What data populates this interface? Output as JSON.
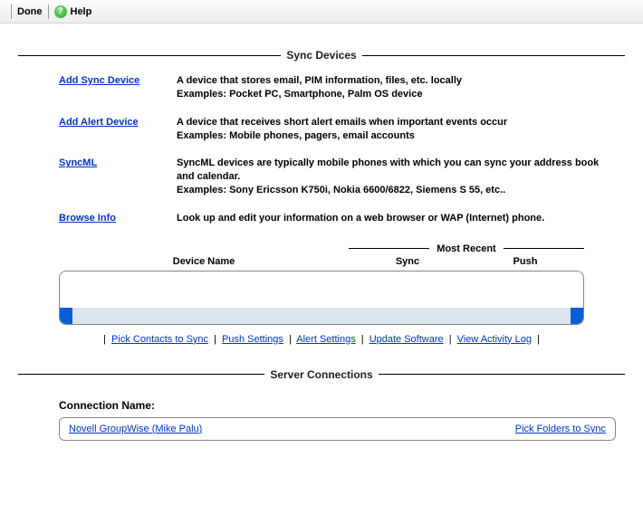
{
  "toolbar": {
    "done": "Done",
    "help": "Help"
  },
  "sections": {
    "sync_devices_title": "Sync Devices",
    "server_connections_title": "Server Connections"
  },
  "defs": [
    {
      "link": "Add Sync Device",
      "desc": "A device that stores email, PIM information, files, etc. locally\nExamples: Pocket PC, Smartphone, Palm OS device"
    },
    {
      "link": "Add Alert Device",
      "desc": "A device that receives short alert emails when important events occur\nExamples: Mobile phones, pagers, email accounts"
    },
    {
      "link": "SyncML",
      "desc": "SyncML devices are typically mobile phones with which you can sync your address book and calendar.\nExamples: Sony Ericsson K750i, Nokia 6600/6822, Siemens S 55, etc.."
    },
    {
      "link": "Browse Info",
      "desc": "Look up and edit your information on a web browser or WAP (Internet) phone."
    }
  ],
  "table": {
    "most_recent": "Most Recent",
    "device_name": "Device Name",
    "sync": "Sync",
    "push": "Push"
  },
  "links": {
    "pick_contacts": "Pick Contacts to Sync",
    "push_settings": "Push Settings",
    "alert_settings": "Alert Settings",
    "update_software": "Update Software",
    "view_activity_log": "View Activity Log"
  },
  "connection": {
    "title": "Connection Name:",
    "name": "Novell GroupWise (Mike Palu)",
    "pick_folders": "Pick Folders to Sync"
  }
}
